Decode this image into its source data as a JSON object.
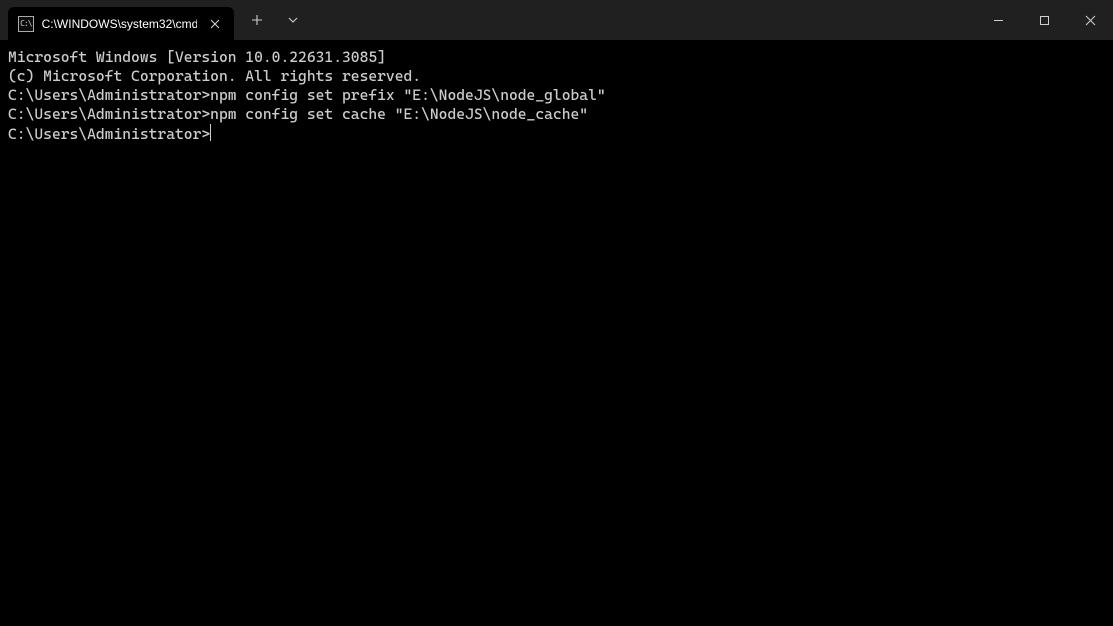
{
  "titlebar": {
    "tab": {
      "title": "C:\\WINDOWS\\system32\\cmd.",
      "icon_text": "C:\\"
    }
  },
  "terminal": {
    "lines": [
      "Microsoft Windows [Version 10.0.22631.3085]",
      "(c) Microsoft Corporation. All rights reserved.",
      "",
      "C:\\Users\\Administrator>npm config set prefix \"E:\\NodeJS\\node_global\"",
      "",
      "C:\\Users\\Administrator>npm config set cache \"E:\\NodeJS\\node_cache\"",
      "",
      "C:\\Users\\Administrator>"
    ]
  }
}
